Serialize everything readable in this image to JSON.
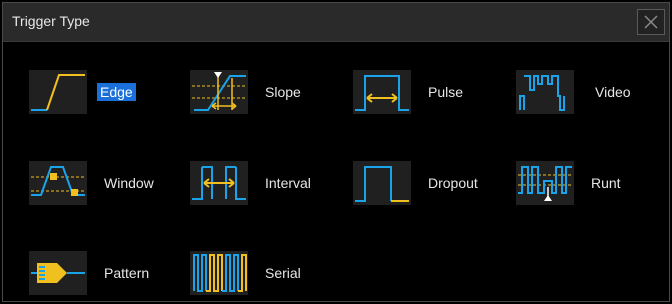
{
  "dialog": {
    "title": "Trigger Type",
    "close_icon": "close-icon"
  },
  "triggers": [
    {
      "id": "edge",
      "label": "Edge",
      "selected": true
    },
    {
      "id": "slope",
      "label": "Slope",
      "selected": false
    },
    {
      "id": "pulse",
      "label": "Pulse",
      "selected": false
    },
    {
      "id": "video",
      "label": "Video",
      "selected": false
    },
    {
      "id": "window",
      "label": "Window",
      "selected": false
    },
    {
      "id": "interval",
      "label": "Interval",
      "selected": false
    },
    {
      "id": "dropout",
      "label": "Dropout",
      "selected": false
    },
    {
      "id": "runt",
      "label": "Runt",
      "selected": false
    },
    {
      "id": "pattern",
      "label": "Pattern",
      "selected": false
    },
    {
      "id": "serial",
      "label": "Serial",
      "selected": false
    }
  ],
  "colors": {
    "signal_blue": "#1aa3e8",
    "marker_yellow": "#f0c020",
    "selected_bg": "#1a6fd8"
  }
}
